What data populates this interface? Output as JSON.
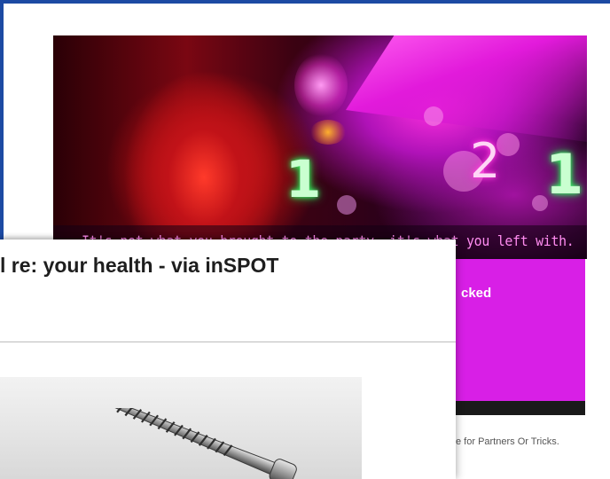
{
  "banner": {
    "caption": "It's not what you brought to the party, it's what you left with.",
    "neon_signs": [
      "1",
      "1",
      "2"
    ]
  },
  "sidebar_box": {
    "partial_text": "cked"
  },
  "footer": {
    "partial_text": "e for Partners Or Tricks."
  },
  "email": {
    "subject_partial": "l re: your health - via inSPOT"
  },
  "colors": {
    "background_blue": "#1c4aa3",
    "magenta": "#d81fe6",
    "caption_pink": "#ff8cf0"
  }
}
